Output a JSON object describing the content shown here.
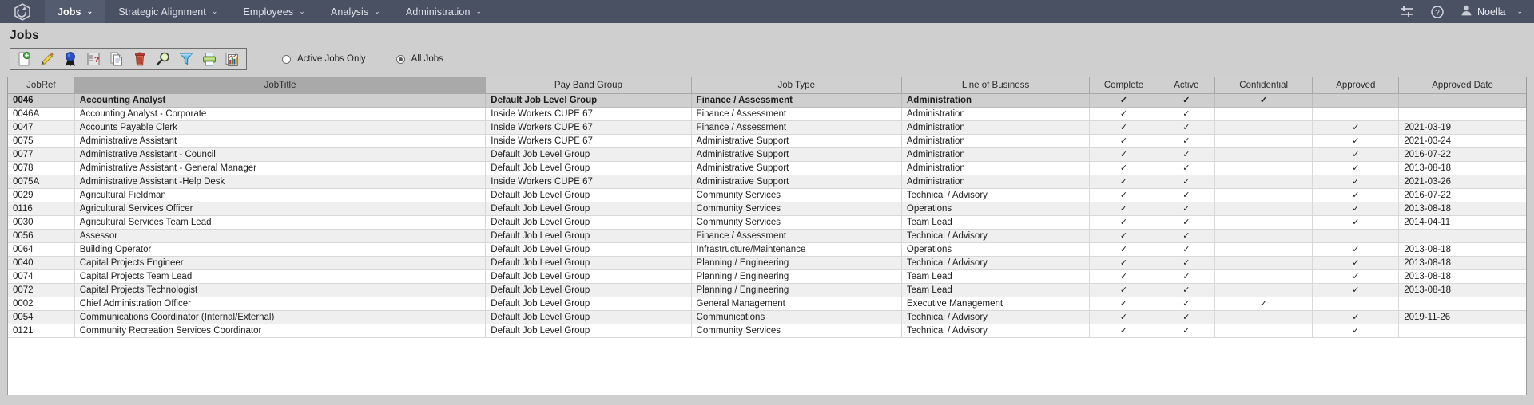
{
  "navbar": {
    "logo_icon": "cube-logo-icon",
    "items": [
      {
        "label": "Jobs",
        "active": true,
        "caret": "⌄"
      },
      {
        "label": "Strategic Alignment",
        "active": false,
        "caret": "⌄"
      },
      {
        "label": "Employees",
        "active": false,
        "caret": "⌄"
      },
      {
        "label": "Analysis",
        "active": false,
        "caret": "⌄"
      },
      {
        "label": "Administration",
        "active": false,
        "caret": "⌄"
      }
    ],
    "settings_icon": "sliders-icon",
    "help_icon": "question-circle-icon",
    "user_icon": "user-avatar-icon",
    "user_name": "Noella",
    "user_caret": "⌄"
  },
  "page": {
    "title": "Jobs"
  },
  "toolbar": {
    "buttons": [
      {
        "name": "new-job-button",
        "icon": "new-document-icon",
        "title": "New"
      },
      {
        "name": "edit-job-button",
        "icon": "pencil-icon",
        "title": "Edit"
      },
      {
        "name": "approve-job-button",
        "icon": "award-ribbon-icon",
        "title": "Approve"
      },
      {
        "name": "questionnaire-button",
        "icon": "form-question-icon",
        "title": "Questionnaire"
      },
      {
        "name": "copy-job-button",
        "icon": "copy-pages-icon",
        "title": "Copy"
      },
      {
        "name": "delete-job-button",
        "icon": "trash-can-icon",
        "title": "Delete"
      },
      {
        "name": "search-button",
        "icon": "magnifier-icon",
        "title": "Search"
      },
      {
        "name": "filter-button",
        "icon": "funnel-icon",
        "title": "Filter"
      },
      {
        "name": "print-button",
        "icon": "printer-icon",
        "title": "Print"
      },
      {
        "name": "reports-button",
        "icon": "chart-reports-icon",
        "title": "Reports"
      }
    ]
  },
  "filters": {
    "options": [
      {
        "label": "Active Jobs Only",
        "selected": false
      },
      {
        "label": "All Jobs",
        "selected": true
      }
    ]
  },
  "grid": {
    "columns": [
      {
        "key": "jobref",
        "label": "JobRef",
        "sorted": false
      },
      {
        "key": "jobtitle",
        "label": "JobTitle",
        "sorted": true
      },
      {
        "key": "payband",
        "label": "Pay Band Group",
        "sorted": false
      },
      {
        "key": "jobtype",
        "label": "Job Type",
        "sorted": false
      },
      {
        "key": "lob",
        "label": "Line of Business",
        "sorted": false
      },
      {
        "key": "complete",
        "label": "Complete",
        "sorted": false
      },
      {
        "key": "active",
        "label": "Active",
        "sorted": false
      },
      {
        "key": "conf",
        "label": "Confidential",
        "sorted": false
      },
      {
        "key": "approved",
        "label": "Approved",
        "sorted": false
      },
      {
        "key": "apprdate",
        "label": "Approved Date",
        "sorted": false
      }
    ],
    "check_glyph": "✓",
    "rows": [
      {
        "jobref": "0046",
        "jobtitle": "Accounting Analyst",
        "payband": "Default Job Level Group",
        "jobtype": "Finance / Assessment",
        "lob": "Administration",
        "complete": true,
        "active": true,
        "conf": true,
        "approved": false,
        "apprdate": "",
        "selected": true
      },
      {
        "jobref": "0046A",
        "jobtitle": "Accounting Analyst - Corporate",
        "payband": "Inside Workers CUPE 67",
        "jobtype": "Finance / Assessment",
        "lob": "Administration",
        "complete": true,
        "active": true,
        "conf": false,
        "approved": false,
        "apprdate": "",
        "selected": false
      },
      {
        "jobref": "0047",
        "jobtitle": "Accounts Payable Clerk",
        "payband": "Inside Workers CUPE 67",
        "jobtype": "Finance / Assessment",
        "lob": "Administration",
        "complete": true,
        "active": true,
        "conf": false,
        "approved": true,
        "apprdate": "2021-03-19",
        "selected": false
      },
      {
        "jobref": "0075",
        "jobtitle": "Administrative Assistant",
        "payband": "Inside Workers CUPE 67",
        "jobtype": "Administrative Support",
        "lob": "Administration",
        "complete": true,
        "active": true,
        "conf": false,
        "approved": true,
        "apprdate": "2021-03-24",
        "selected": false
      },
      {
        "jobref": "0077",
        "jobtitle": "Administrative Assistant - Council",
        "payband": "Default Job Level Group",
        "jobtype": "Administrative Support",
        "lob": "Administration",
        "complete": true,
        "active": true,
        "conf": false,
        "approved": true,
        "apprdate": "2016-07-22",
        "selected": false
      },
      {
        "jobref": "0078",
        "jobtitle": "Administrative Assistant - General Manager",
        "payband": "Default Job Level Group",
        "jobtype": "Administrative Support",
        "lob": "Administration",
        "complete": true,
        "active": true,
        "conf": false,
        "approved": true,
        "apprdate": "2013-08-18",
        "selected": false
      },
      {
        "jobref": "0075A",
        "jobtitle": "Administrative Assistant -Help Desk",
        "payband": "Inside Workers CUPE 67",
        "jobtype": "Administrative Support",
        "lob": "Administration",
        "complete": true,
        "active": true,
        "conf": false,
        "approved": true,
        "apprdate": "2021-03-26",
        "selected": false
      },
      {
        "jobref": "0029",
        "jobtitle": "Agricultural Fieldman",
        "payband": "Default Job Level Group",
        "jobtype": "Community Services",
        "lob": "Technical / Advisory",
        "complete": true,
        "active": true,
        "conf": false,
        "approved": true,
        "apprdate": "2016-07-22",
        "selected": false
      },
      {
        "jobref": "0116",
        "jobtitle": "Agricultural Services Officer",
        "payband": "Default Job Level Group",
        "jobtype": "Community Services",
        "lob": "Operations",
        "complete": true,
        "active": true,
        "conf": false,
        "approved": true,
        "apprdate": "2013-08-18",
        "selected": false
      },
      {
        "jobref": "0030",
        "jobtitle": "Agricultural Services Team Lead",
        "payband": "Default Job Level Group",
        "jobtype": "Community Services",
        "lob": "Team Lead",
        "complete": true,
        "active": true,
        "conf": false,
        "approved": true,
        "apprdate": "2014-04-11",
        "selected": false
      },
      {
        "jobref": "0056",
        "jobtitle": "Assessor",
        "payband": "Default Job Level Group",
        "jobtype": "Finance / Assessment",
        "lob": "Technical / Advisory",
        "complete": true,
        "active": true,
        "conf": false,
        "approved": false,
        "apprdate": "",
        "selected": false
      },
      {
        "jobref": "0064",
        "jobtitle": "Building Operator",
        "payband": "Default Job Level Group",
        "jobtype": "Infrastructure/Maintenance",
        "lob": "Operations",
        "complete": true,
        "active": true,
        "conf": false,
        "approved": true,
        "apprdate": "2013-08-18",
        "selected": false
      },
      {
        "jobref": "0040",
        "jobtitle": "Capital Projects Engineer",
        "payband": "Default Job Level Group",
        "jobtype": "Planning / Engineering",
        "lob": "Technical / Advisory",
        "complete": true,
        "active": true,
        "conf": false,
        "approved": true,
        "apprdate": "2013-08-18",
        "selected": false
      },
      {
        "jobref": "0074",
        "jobtitle": "Capital Projects Team Lead",
        "payband": "Default Job Level Group",
        "jobtype": "Planning / Engineering",
        "lob": "Team Lead",
        "complete": true,
        "active": true,
        "conf": false,
        "approved": true,
        "apprdate": "2013-08-18",
        "selected": false
      },
      {
        "jobref": "0072",
        "jobtitle": "Capital Projects Technologist",
        "payband": "Default Job Level Group",
        "jobtype": "Planning / Engineering",
        "lob": "Team Lead",
        "complete": true,
        "active": true,
        "conf": false,
        "approved": true,
        "apprdate": "2013-08-18",
        "selected": false
      },
      {
        "jobref": "0002",
        "jobtitle": "Chief Administration Officer",
        "payband": "Default Job Level Group",
        "jobtype": "General Management",
        "lob": "Executive Management",
        "complete": true,
        "active": true,
        "conf": true,
        "approved": false,
        "apprdate": "",
        "selected": false
      },
      {
        "jobref": "0054",
        "jobtitle": "Communications Coordinator (Internal/External)",
        "payband": "Default Job Level Group",
        "jobtype": "Communications",
        "lob": "Technical / Advisory",
        "complete": true,
        "active": true,
        "conf": false,
        "approved": true,
        "apprdate": "2019-11-26",
        "selected": false
      },
      {
        "jobref": "0121",
        "jobtitle": "Community Recreation Services Coordinator",
        "payband": "Default Job Level Group",
        "jobtype": "Community Services",
        "lob": "Technical / Advisory",
        "complete": true,
        "active": true,
        "conf": false,
        "approved": true,
        "apprdate": "",
        "selected": false
      }
    ]
  }
}
